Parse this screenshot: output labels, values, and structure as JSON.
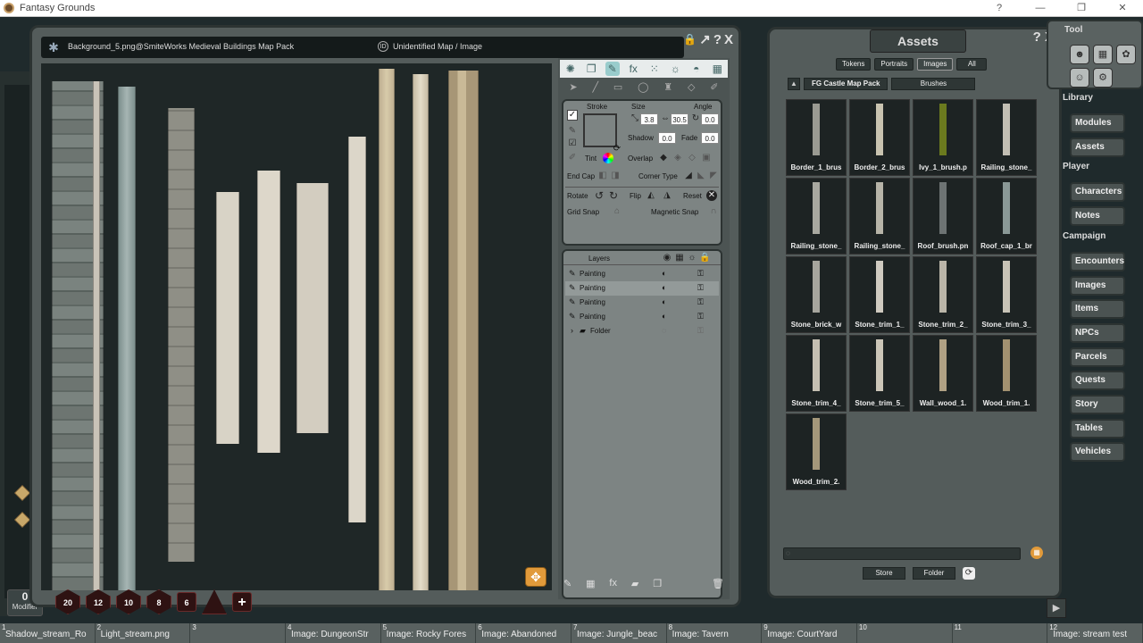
{
  "app": {
    "title": "Fantasy Grounds",
    "window_buttons": [
      "?",
      "—",
      "❐",
      "✕"
    ]
  },
  "modifier": {
    "value": "0",
    "label": "Modifier"
  },
  "image_window": {
    "tab_title": "Background_5.png@SmiteWorks Medieval Buildings Map Pack",
    "id_badge": "ID",
    "subtitle": "Unidentified Map / Image",
    "controls": [
      "↗",
      "?",
      "X"
    ]
  },
  "paint_panel": {
    "stroke_label": "Stroke",
    "size_label": "Size",
    "angle_label": "Angle",
    "size_value": "3.8",
    "size_value2": "30.5",
    "angle_value": "0.0",
    "shadow_label": "Shadow",
    "shadow_value": "0.0",
    "fade_label": "Fade",
    "fade_value": "0.0",
    "tint_label": "Tint",
    "overlap_label": "Overlap",
    "endcap_label": "End Cap",
    "corner_label": "Corner Type",
    "rotate_label": "Rotate",
    "flip_label": "Flip",
    "reset_label": "Reset",
    "gridsnap_label": "Grid Snap",
    "magsnap_label": "Magnetic Snap"
  },
  "layers": {
    "title": "Layers",
    "items": [
      {
        "name": "Painting"
      },
      {
        "name": "Painting"
      },
      {
        "name": "Painting"
      },
      {
        "name": "Painting"
      },
      {
        "name": "Folder"
      }
    ]
  },
  "assets": {
    "title": "Assets",
    "filters": [
      "Tokens",
      "Portraits",
      "Images",
      "All"
    ],
    "pack": "FG Castle Map Pack",
    "brushes": "Brushes",
    "items": [
      {
        "name": "Border_1_brus",
        "color": "#9a9a92"
      },
      {
        "name": "Border_2_brus",
        "color": "#c9c3b0"
      },
      {
        "name": "Ivy_1_brush.p",
        "color": "#6b7a1e"
      },
      {
        "name": "Railing_stone_",
        "color": "#c2beb3"
      },
      {
        "name": "Railing_stone_",
        "color": "#a8a8a0"
      },
      {
        "name": "Railing_stone_",
        "color": "#b7b4a8"
      },
      {
        "name": "Roof_brush.pn",
        "color": "#6d7373"
      },
      {
        "name": "Roof_cap_1_br",
        "color": "#8a9896"
      },
      {
        "name": "Stone_brick_w",
        "color": "#a6a59d"
      },
      {
        "name": "Stone_trim_1_",
        "color": "#cfcac0"
      },
      {
        "name": "Stone_trim_2_",
        "color": "#bab5a8"
      },
      {
        "name": "Stone_trim_3_",
        "color": "#c8c3b6"
      },
      {
        "name": "Stone_trim_4_",
        "color": "#c5bfb2"
      },
      {
        "name": "Stone_trim_5_",
        "color": "#ccc6b8"
      },
      {
        "name": "Wall_wood_1.",
        "color": "#b0a184"
      },
      {
        "name": "Wood_trim_1.",
        "color": "#a29170"
      },
      {
        "name": "Wood_trim_2.",
        "color": "#a4977a"
      }
    ],
    "store": "Store",
    "folder": "Folder"
  },
  "sidebar": {
    "tool_label": "Tool",
    "categories": [
      {
        "label": "Library",
        "buttons": [
          "Modules",
          "Assets"
        ]
      },
      {
        "label": "Player",
        "buttons": [
          "Characters",
          "Notes"
        ]
      },
      {
        "label": "Campaign",
        "buttons": [
          "Encounters",
          "Images",
          "Items",
          "NPCs",
          "Parcels",
          "Quests",
          "Story",
          "Tables",
          "Vehicles"
        ]
      }
    ]
  },
  "dice": [
    "20",
    "12",
    "10",
    "8",
    "6",
    "4",
    "+"
  ],
  "hotbar": [
    {
      "num": "1",
      "label": "Shadow_stream_Ro"
    },
    {
      "num": "2",
      "label": "Light_stream.png"
    },
    {
      "num": "3",
      "label": ""
    },
    {
      "num": "4",
      "label": "Image: DungeonStr"
    },
    {
      "num": "5",
      "label": "Image: Rocky Fores"
    },
    {
      "num": "6",
      "label": "Image: Abandoned"
    },
    {
      "num": "7",
      "label": "Image: Jungle_beac"
    },
    {
      "num": "8",
      "label": "Image: Tavern"
    },
    {
      "num": "9",
      "label": "Image: CourtYard"
    },
    {
      "num": "10",
      "label": ""
    },
    {
      "num": "11",
      "label": ""
    },
    {
      "num": "12",
      "label": "Image: stream test"
    }
  ]
}
